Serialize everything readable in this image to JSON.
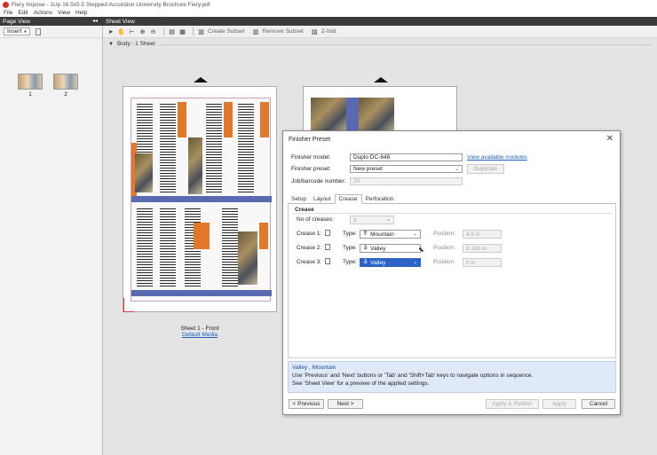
{
  "window": {
    "title": "Fiery Impose - 1Up 16.5x5.5 Stepped Accordion University Brochure Fiery.pdf"
  },
  "menu": [
    "File",
    "Edit",
    "Actions",
    "View",
    "Help"
  ],
  "left_pane": {
    "title": "Page View",
    "insert_label": "Insert",
    "thumbnails": [
      {
        "label": "1"
      },
      {
        "label": "2"
      }
    ]
  },
  "sheet_view": {
    "title": "Sheet View",
    "toolbar": {
      "create_subset": "Create Subset",
      "remove_subset": "Remove Subset",
      "z_fold": "Z-fold"
    },
    "body_label": "Body : 1 Sheet",
    "sheet_caption": "Sheet 1 - Front",
    "media_link": "Default Media"
  },
  "dialog": {
    "title": "Finisher Preset",
    "finisher_model_label": "Finisher model:",
    "finisher_model_value": "Duplo DC-648",
    "view_modules_link": "View available modules",
    "finisher_preset_label": "Finisher preset:",
    "finisher_preset_value": "New preset",
    "duplicate_label": "Duplicate",
    "job_barcode_label": "Job/barcode number:",
    "job_barcode_value": "20",
    "tabs": [
      "Setup",
      "Layout",
      "Crease",
      "Perforation"
    ],
    "active_tab": "Crease",
    "crease_group_title": "Crease",
    "num_creases_label": "No of creases:",
    "num_creases_value": "3",
    "type_label": "Type:",
    "position_label": "Position:",
    "creases": [
      {
        "label": "Crease 1:",
        "type": "Mountain",
        "position": "4.5 in"
      },
      {
        "label": "Crease 2:",
        "type": "Valley",
        "position": "8.248 in"
      },
      {
        "label": "Crease 3:",
        "type": "Valley",
        "position": "0 in"
      }
    ],
    "info": {
      "highlight": "Valley , Mountain",
      "line1": "Use 'Previous' and 'Next' buttons or 'Tab' and 'Shift+Tab' keys to navigate options in sequence.",
      "line2": "See 'Sheet View' for a preview of the applied settings."
    },
    "buttons": {
      "previous": "< Previous",
      "next": "Next >",
      "apply_publish": "Apply & Publish",
      "apply": "Apply",
      "cancel": "Cancel"
    }
  },
  "colors": {
    "accent": "#2b63c6",
    "brand": "#d6322b",
    "brochure_orange": "#e07a2a"
  }
}
